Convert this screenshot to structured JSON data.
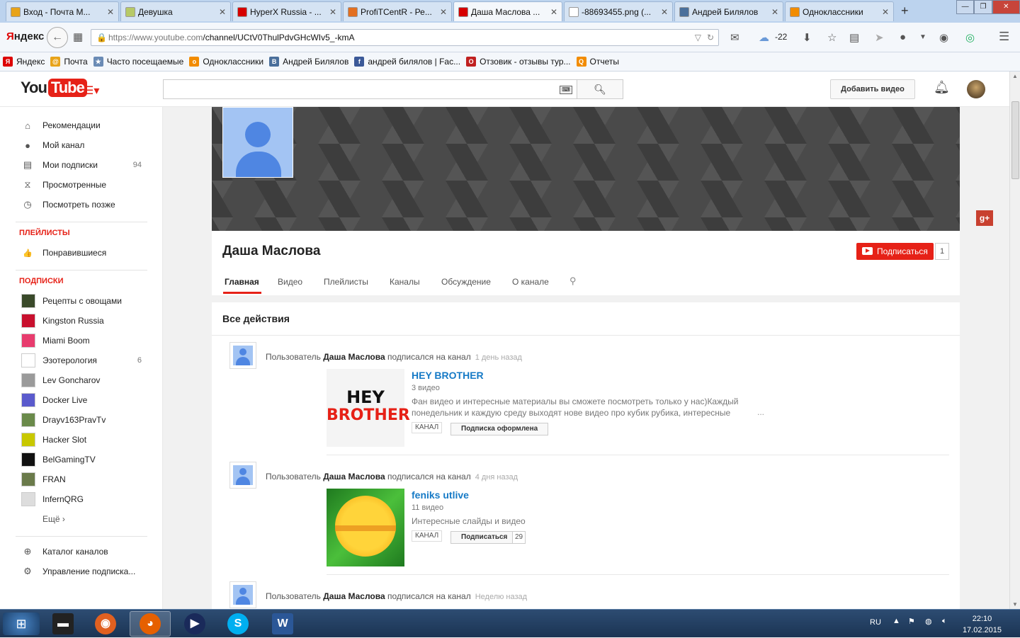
{
  "browser": {
    "tabs": [
      {
        "label": "Вход - Почта М...",
        "color": "#e8a319"
      },
      {
        "label": "Девушка",
        "color": "#b7c967"
      },
      {
        "label": "HyperX Russia - ...",
        "color": "#d60000"
      },
      {
        "label": "ProfiTCentR - Ре...",
        "color": "#e36f20"
      },
      {
        "label": "Даша Маслова ...",
        "color": "#d60000"
      },
      {
        "label": "-88693455.png (...",
        "color": "#ffffff"
      },
      {
        "label": "Андрей Билялов",
        "color": "#4a6f9b"
      },
      {
        "label": "Одноклассники",
        "color": "#f28c00"
      }
    ],
    "new_tab": "+",
    "brand": {
      "ya": "Я",
      "ndex": "ндекс"
    },
    "url_host": "https://www.youtube.com",
    "url_path": "/channel/UCtV0ThulPdvGHcWIv5_-kmA",
    "weather": "-22",
    "bookmarks": [
      {
        "label": "Яндекс",
        "color": "#d00",
        "glyph": "Я"
      },
      {
        "label": "Почта",
        "color": "#e8a319",
        "glyph": "@"
      },
      {
        "label": "Часто посещаемые",
        "color": "#6a8bb5",
        "glyph": "★"
      },
      {
        "label": "Одноклассники",
        "color": "#f28c00",
        "glyph": "о"
      },
      {
        "label": "Андрей Билялов",
        "color": "#4a6f9b",
        "glyph": "В"
      },
      {
        "label": "андрей билялов | Fac...",
        "color": "#3b5998",
        "glyph": "f"
      },
      {
        "label": "Отзовик - отзывы тур...",
        "color": "#c02020",
        "glyph": "О"
      },
      {
        "label": "Отчеты",
        "color": "#f28c00",
        "glyph": "Q"
      }
    ]
  },
  "youtube": {
    "logo_you": "You",
    "logo_tube": "Tube",
    "upload_label": "Добавить видео",
    "search_placeholder": ""
  },
  "sidebar": {
    "main": [
      {
        "label": "Рекомендации",
        "icon": "home-icon",
        "glyph": "⌂",
        "count": ""
      },
      {
        "label": "Мой канал",
        "icon": "user-icon",
        "glyph": "●",
        "count": ""
      },
      {
        "label": "Мои подписки",
        "icon": "subscriptions-icon",
        "glyph": "▤",
        "count": "94"
      },
      {
        "label": "Просмотренные",
        "icon": "history-icon",
        "glyph": "⧖",
        "count": ""
      },
      {
        "label": "Посмотреть позже",
        "icon": "clock-icon",
        "glyph": "◷",
        "count": ""
      }
    ],
    "playlists_header": "ПЛЕЙЛИСТЫ",
    "playlists": [
      {
        "label": "Понравившиеся",
        "icon": "thumbs-up-icon",
        "glyph": "👍"
      }
    ],
    "subs_header": "ПОДПИСКИ",
    "subs": [
      {
        "label": "Рецепты с овощами",
        "color": "#3a4a2a",
        "count": ""
      },
      {
        "label": "Kingston Russia",
        "color": "#c8102e",
        "count": ""
      },
      {
        "label": "Miami Boom",
        "color": "#e83c6e",
        "count": ""
      },
      {
        "label": "Эзотерология",
        "color": "#ffffff",
        "count": "6"
      },
      {
        "label": "Lev Goncharov",
        "color": "#9a9a9a",
        "count": ""
      },
      {
        "label": "Docker Live",
        "color": "#5a5acc",
        "count": ""
      },
      {
        "label": "Drayv163PravTv",
        "color": "#6a8a4a",
        "count": ""
      },
      {
        "label": "Hacker Slot",
        "color": "#c8c800",
        "count": ""
      },
      {
        "label": "BelGamingTV",
        "color": "#111111",
        "count": ""
      },
      {
        "label": "FRAN",
        "color": "#6a7a4a",
        "count": ""
      },
      {
        "label": "InfernQRG",
        "color": "#dddddd",
        "count": ""
      }
    ],
    "more_label": "Ещё ›",
    "bottom": [
      {
        "label": "Каталог каналов",
        "icon": "plus-circle-icon",
        "glyph": "⊕"
      },
      {
        "label": "Управление подписка...",
        "icon": "gear-icon",
        "glyph": "⚙"
      }
    ]
  },
  "channel": {
    "name": "Даша Маслова",
    "subscribe_label": "Подписаться",
    "subscriber_count": "1",
    "gplus": "g+",
    "tabs": [
      "Главная",
      "Видео",
      "Плейлисты",
      "Каналы",
      "Обсуждение",
      "О канале"
    ],
    "active_tab": 0,
    "feed_title": "Все действия"
  },
  "activities": [
    {
      "prefix": "Пользователь ",
      "user": "Даша Маслова",
      "action": " подписался на канал",
      "time": "1 день назад",
      "channel_title": "HEY BROTHER",
      "channel_videos": "3 видео",
      "channel_desc": "Фан видео и интересные материалы вы сможете посмотреть только у нас)Каждый понедельник и каждую среду выходят нове видео про кубик рубика, интересные",
      "ellipsis": "...",
      "badge": "КАНАЛ",
      "button": "Подписка оформлена",
      "count": "",
      "thumb_text": {
        "line1": "HEY",
        "line2": "BROTHER"
      }
    },
    {
      "prefix": "Пользователь ",
      "user": "Даша Маслова",
      "action": " подписался на канал",
      "time": "4 дня назад",
      "channel_title": "feniks utlive",
      "channel_videos": "11 видео",
      "channel_desc": "Интересные слайды и видео",
      "ellipsis": "",
      "badge": "КАНАЛ",
      "button": "Подписаться",
      "count": "29"
    },
    {
      "prefix": "Пользователь ",
      "user": "Даша Маслова",
      "action": " подписался на канал",
      "time": "Неделю назад"
    }
  ],
  "taskbar": {
    "start_glyph": "⊞",
    "apps": [
      {
        "name": "desktop-icon",
        "glyph": "▬",
        "color": "#222"
      },
      {
        "name": "image-viewer-icon",
        "glyph": "◉",
        "color": "#e06020"
      },
      {
        "name": "firefox-icon",
        "glyph": "◕",
        "color": "#e66000"
      },
      {
        "name": "media-player-icon",
        "glyph": "▶",
        "color": "#1a2a5a"
      },
      {
        "name": "skype-icon",
        "glyph": "S",
        "color": "#00aff0"
      },
      {
        "name": "word-icon",
        "glyph": "W",
        "color": "#2b5797"
      }
    ],
    "lang": "RU",
    "time": "22:10",
    "date": "17.02.2015"
  }
}
